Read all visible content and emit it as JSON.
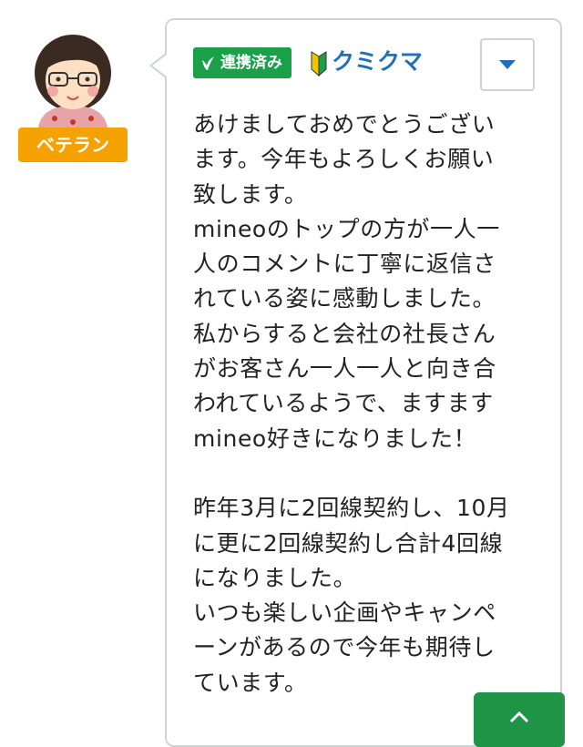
{
  "user": {
    "rank": "ベテラン",
    "linked_label": "連携済み",
    "name": "クミクマ"
  },
  "comment": {
    "lines": [
      "あけましておめでとうござい",
      "ます。今年もよろしくお願い",
      "致します。",
      "mineoのトップの方が一人一",
      "人のコメントに丁寧に返信さ",
      "れている姿に感動しました。",
      "私からすると会社の社長さん",
      "がお客さん一人一人と向き合",
      "われているようで、ますます",
      "mineo好きになりました！",
      "",
      "昨年3月に2回線契約し、10月",
      "に更に2回線契約し合計4回線",
      "になりました。",
      "いつも楽しい企画やキャンペ",
      "ーンがあるので今年も期待し",
      "ています。"
    ]
  },
  "icons": {
    "menu": "chevron-down-icon",
    "beginner": "beginner-mark-icon",
    "linked": "leaf-check-icon",
    "scroll": "chevron-up-icon"
  },
  "colors": {
    "accent_blue": "#1e6fbf",
    "linked_green": "#1aa049",
    "rank_orange": "#f5a100"
  }
}
